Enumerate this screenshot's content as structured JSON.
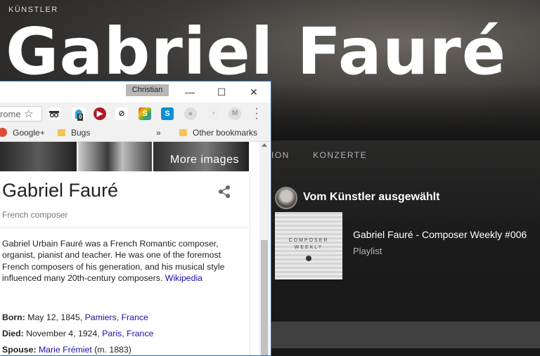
{
  "spotify": {
    "kicker": "KÜNSTLER",
    "artist_name": "Gabriel Fauré",
    "tabs": [
      "ION",
      "KONZERTE"
    ],
    "artist_pick": {
      "heading": "Vom Künstler ausgewählt",
      "item_title": "Gabriel Fauré - Composer Weekly #006",
      "item_type": "Playlist",
      "cover_text_line1": "COMPOSER",
      "cover_text_line2": "WEEKLY"
    }
  },
  "chrome": {
    "profile_name": "Christian",
    "window_buttons": {
      "minimize": "—",
      "maximize": "☐",
      "close": "✕"
    },
    "omnibox_text": "rome",
    "bookmarks": [
      {
        "label": "Google+",
        "icon": "google-plus-icon"
      },
      {
        "label": "Bugs",
        "icon": "folder-icon"
      },
      {
        "label": "»",
        "icon": ""
      },
      {
        "label": "Other bookmarks",
        "icon": "folder-icon"
      }
    ],
    "extension_badge": "0"
  },
  "knowledge_panel": {
    "more_images": "More images",
    "title": "Gabriel Fauré",
    "subtitle": "French composer",
    "description": "Gabriel Urbain Fauré was a French Romantic composer, organist, pianist and teacher. He was one of the foremost French composers of his generation, and his musical style influenced many 20th-century composers.",
    "description_link": "Wikipedia",
    "born_label": "Born:",
    "born_value": "May 12, 1845,",
    "born_place1": "Pamiers",
    "born_place2": "France",
    "died_label": "Died:",
    "died_value": "November 4, 1924,",
    "died_place1": "Paris",
    "died_place2": "France",
    "spouse_label": "Spouse:",
    "spouse_name": "Marie Frémiet",
    "spouse_year": "(m. 1883)"
  },
  "colors": {
    "spotify_bg": "#121212",
    "link": "#1a0dab",
    "window_border": "#1e6fc7"
  }
}
